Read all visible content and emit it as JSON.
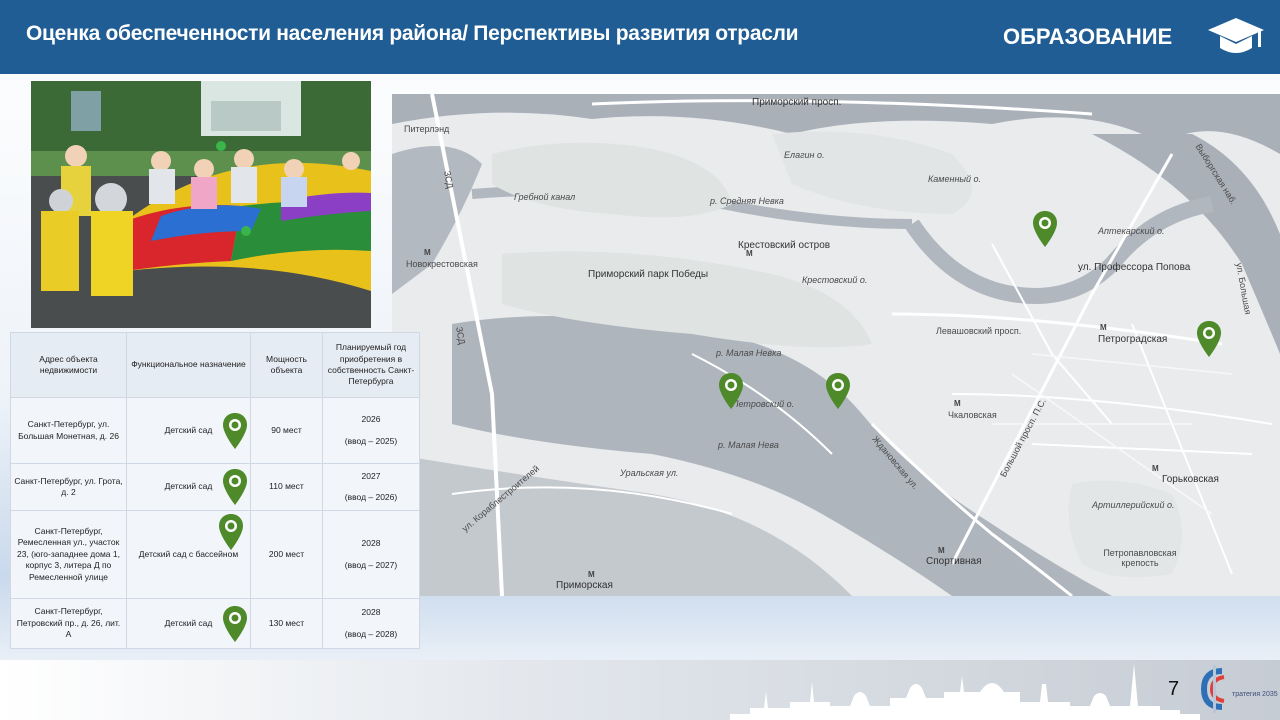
{
  "header": {
    "title": "Оценка обеспеченности населения района/ Перспективы развития отрасли",
    "section": "ОБРАЗОВАНИЕ",
    "section_icon": "graduation-cap-icon"
  },
  "colors": {
    "header_bg": "#1f5d94",
    "pin_green": "#4f8a2a",
    "table_header_bg": "#e6ecf4",
    "table_cell_bg": "#f2f6fb"
  },
  "map": {
    "labels": {
      "piterland": "Питерлэнд",
      "primorsky_prosp": "Приморский просп.",
      "elagin": "Елагин о.",
      "kamenny": "Каменный о.",
      "grebnoy": "Гребной канал",
      "srednyaya_nevka": "р. Средняя Невка",
      "krestovsky_island": "Крестовский остров",
      "novokrestovskaya": "Новокрестовская",
      "park_pobedy": "Приморский парк Победы",
      "krestovsky_o": "Крестовский о.",
      "aptekarsky": "Аптекарский о.",
      "prof_popova": "ул. Профессора Попова",
      "vyborgskaya": "Выборгская наб.",
      "bolshaya_up": "ул. Большая",
      "levashovsky": "Левашовский просп.",
      "petrogradskaya": "Петроградская",
      "malaya_nevka_1": "р. Малая Невка",
      "petrovsky": "Петровский о.",
      "chkalovskaya": "Чкаловская",
      "bolshoy_prosp": "Большой просп. П.С.",
      "malaya_nevka_2": "р. Малая Нева",
      "zhdanovskaya": "Ждановская ул.",
      "uralskaya": "Уральская ул.",
      "korablestroiteley": "ул. Кораблестроителей",
      "gorkovskaya": "Горьковская",
      "artilleriysky": "Артиллерийский о.",
      "petropavlovskaya": "Петропавловская крепость",
      "sportivnaya": "Спортивная",
      "primorskaya": "Приморская",
      "zsd_1": "ЗСД",
      "zsd_2": "ЗСД",
      "metro_glyph": "M"
    },
    "pin_icon": "map-pin-icon"
  },
  "table": {
    "headers": [
      "Адрес объекта недвижимости",
      "Функциональное назначение",
      "Мощность объекта",
      "Планируемый год приобретения в собственность Санкт-Петербурга"
    ],
    "rows": [
      {
        "address": "Санкт-Петербург, ул. Большая Монетная, д. 26",
        "function": "Детский сад",
        "capacity": "90 мест",
        "year": "2026",
        "commission": "(ввод – 2025)"
      },
      {
        "address": "Санкт-Петербург, ул. Грота, д. 2",
        "function": "Детский сад",
        "capacity": "110 мест",
        "year": "2027",
        "commission": "(ввод – 2026)"
      },
      {
        "address": "Санкт-Петербург, Ремесленная ул., участок 23, (юго-западнее дома 1, корпус 3, литера Д по Ремесленной улице",
        "function": "Детский сад с бассейном",
        "capacity": "200 мест",
        "year": "2028",
        "commission": "(ввод – 2027)"
      },
      {
        "address": "Санкт-Петербург, Петровский пр., д. 26, лит. А",
        "function": "Детский сад",
        "capacity": "130 мест",
        "year": "2028",
        "commission": "(ввод – 2028)"
      }
    ]
  },
  "footer": {
    "page_number": "7",
    "brand_text": "тратегия 2035",
    "brand_icon": "strategy-2035-logo"
  }
}
